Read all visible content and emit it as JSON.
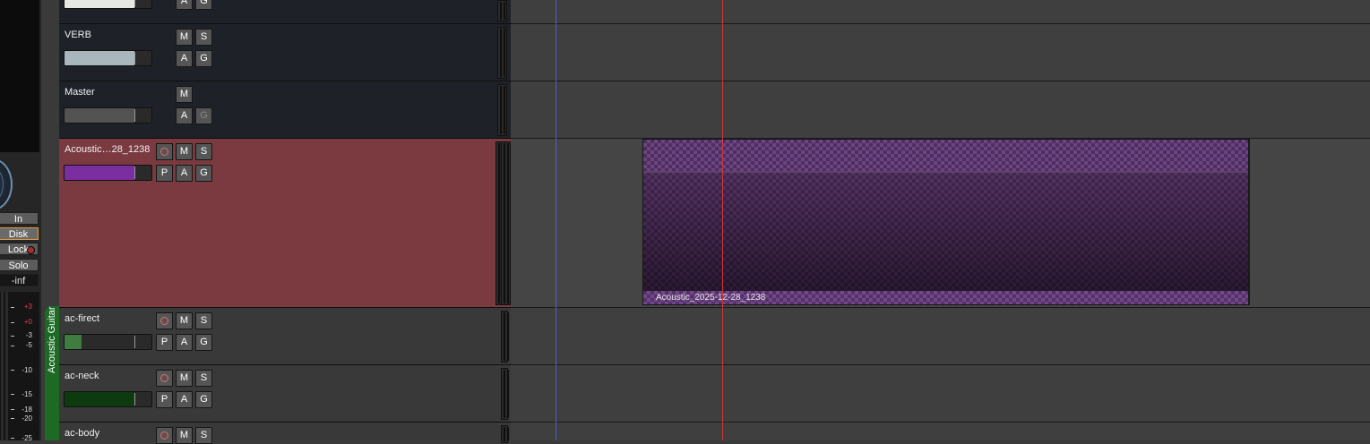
{
  "strip": {
    "buttons": {
      "in": "In",
      "disk": "Disk",
      "lock": "Lock",
      "solo": "Solo",
      "level": "-inf"
    },
    "meter_ticks": [
      {
        "label": "+3",
        "red": true
      },
      {
        "label": "+0",
        "red": true
      },
      {
        "label": "-3",
        "red": false
      },
      {
        "label": "-5",
        "red": false
      },
      {
        "label": "-10",
        "red": false
      },
      {
        "label": "-15",
        "red": false
      },
      {
        "label": "-18",
        "red": false
      },
      {
        "label": "-20",
        "red": false
      },
      {
        "label": "-25",
        "red": false
      }
    ]
  },
  "group": {
    "label": "Acoustic Guitar",
    "color": "#1d6a25"
  },
  "tracks": [
    {
      "name": "",
      "fader_color": "#e6e6e2",
      "fader_level": 0.8,
      "buttons": [
        "A",
        "G"
      ]
    },
    {
      "name": "VERB",
      "fader_color": "#a9b6bc",
      "fader_level": 0.8,
      "buttons_top": [
        "M",
        "S"
      ],
      "buttons": [
        "A",
        "G"
      ]
    },
    {
      "name": "Master",
      "fader_color": "#535353",
      "fader_level": 0.8,
      "buttons_top": [
        "M"
      ],
      "buttons": [
        "A",
        "G"
      ]
    },
    {
      "name": "Acoustic…28_1238",
      "fader_color": "#7a2ea0",
      "fader_level": 0.8,
      "buttons_top": [
        "M",
        "S"
      ],
      "buttons": [
        "P",
        "A",
        "G"
      ]
    },
    {
      "name": "ac-firect",
      "fader_color": "#3f7c3f",
      "fader_level": 0.2,
      "buttons_top": [
        "M",
        "S"
      ],
      "buttons": [
        "P",
        "A",
        "G"
      ]
    },
    {
      "name": "ac-neck",
      "fader_color": "#0e3a10",
      "fader_level": 0.8,
      "buttons_top": [
        "M",
        "S"
      ],
      "buttons": [
        "P",
        "A",
        "G"
      ]
    },
    {
      "name": "ac-body",
      "buttons_top": [
        "M",
        "S"
      ]
    }
  ],
  "region": {
    "name": "Acoustic_2025-12-28_1238",
    "color": "#6b4580"
  },
  "colors": {
    "playhead": "#d03a3a",
    "edit_point": "#4b5fd0",
    "record_track": "#7a3a40"
  }
}
